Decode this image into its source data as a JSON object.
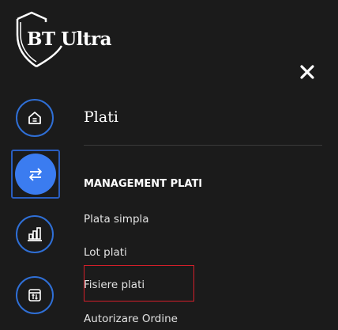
{
  "logo": {
    "text": "BT Ultra",
    "icon": "shield-logo"
  },
  "close": {
    "icon": "close-icon"
  },
  "nav": [
    {
      "icon": "home-icon",
      "active": false
    },
    {
      "icon": "transfer-arrows-icon",
      "active": true
    },
    {
      "icon": "bar-chart-icon",
      "active": false
    },
    {
      "icon": "calendar-exchange-icon",
      "active": false
    }
  ],
  "section": {
    "title": "Plati"
  },
  "menu": {
    "header": "MANAGEMENT PLATI",
    "items": [
      "Plata simpla",
      "Lot plati",
      "Fisiere plati",
      "Autorizare Ordine"
    ]
  },
  "colors": {
    "background": "#1b1b1b",
    "accent": "#3b7cf0",
    "ring": "#2f6fd6",
    "highlight": "#d21f2a"
  }
}
